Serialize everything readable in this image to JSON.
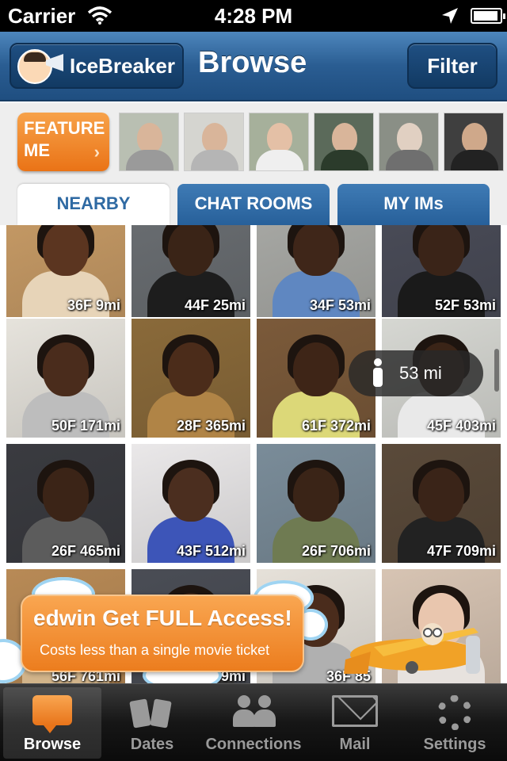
{
  "status_bar": {
    "carrier": "Carrier",
    "time": "4:28 PM"
  },
  "nav": {
    "logo_text": "IceBreaker",
    "title": "Browse",
    "filter_label": "Filter"
  },
  "feature": {
    "button_line1": "FEATURE",
    "button_line2": "ME",
    "chevron": "›"
  },
  "tabs": [
    {
      "label": "NEARBY",
      "active": true
    },
    {
      "label": "CHAT ROOMS",
      "active": false
    },
    {
      "label": "MY IMs",
      "active": false
    }
  ],
  "profiles": [
    {
      "caption": "36F 9mi",
      "bg": "#c79b66",
      "skin": "#5b3520",
      "shirt": "#e7d4b8"
    },
    {
      "caption": "44F 25mi",
      "bg": "#6a6e72",
      "skin": "#3a2417",
      "shirt": "#1d1d1d"
    },
    {
      "caption": "34F 53mi",
      "bg": "#a9aaa6",
      "skin": "#3f2619",
      "shirt": "#5f87c1"
    },
    {
      "caption": "52F 53mi",
      "bg": "#4a4c58",
      "skin": "#3a2418",
      "shirt": "#1a1a1a"
    },
    {
      "caption": "50F 171mi",
      "bg": "#e6e3dc",
      "skin": "#4a2c1c",
      "shirt": "#bdbdbd"
    },
    {
      "caption": "28F 365mi",
      "bg": "#8a6a3a",
      "skin": "#4b2c1a",
      "shirt": "#b08446"
    },
    {
      "caption": "61F 372mi",
      "bg": "#7b5a3a",
      "skin": "#3e2517",
      "shirt": "#dcd878"
    },
    {
      "caption": "45F 403mi",
      "bg": "#d6d7d2",
      "skin": "#3a2417",
      "shirt": "#e9e9e9"
    },
    {
      "caption": "26F 465mi",
      "bg": "#3a3b40",
      "skin": "#3b2417",
      "shirt": "#5c5c5c"
    },
    {
      "caption": "43F 512mi",
      "bg": "#eae8e9",
      "skin": "#4b2e1f",
      "shirt": "#3d55b8"
    },
    {
      "caption": "26F 706mi",
      "bg": "#7a8c99",
      "skin": "#3a2417",
      "shirt": "#6f7b52"
    },
    {
      "caption": "47F 709mi",
      "bg": "#5a4a3a",
      "skin": "#3a2418",
      "shirt": "#222222"
    },
    {
      "caption": "56F 761mi",
      "bg": "#b88a56",
      "skin": "#5b3520",
      "shirt": "#d2b48a"
    },
    {
      "caption": "47F 849mi",
      "bg": "#4a4d55",
      "skin": "#3a2417",
      "shirt": "#3a3a3a"
    },
    {
      "caption": "36F 85",
      "bg": "#e6e1d9",
      "skin": "#4a2c1c",
      "shirt": "#b0b0b0"
    },
    {
      "caption": "",
      "bg": "#d7c4b3",
      "skin": "#e9c6ae",
      "shirt": "#e7e2de"
    }
  ],
  "distance_popup": {
    "text": "53 mi"
  },
  "promo": {
    "headline": "edwin Get FULL Access!",
    "subline": "Costs less than a single movie ticket"
  },
  "tabbar": [
    {
      "label": "Browse",
      "icon": "speech-bubble-icon",
      "active": true
    },
    {
      "label": "Dates",
      "icon": "mugs-icon",
      "active": false
    },
    {
      "label": "Connections",
      "icon": "people-icon",
      "active": false
    },
    {
      "label": "Mail",
      "icon": "envelope-icon",
      "active": false
    },
    {
      "label": "Settings",
      "icon": "gear-icon",
      "active": false
    }
  ],
  "colors": {
    "nav_blue": "#2a5d92",
    "accent_orange": "#ec7d1e",
    "tab_text_active": "#2f6aa3"
  }
}
